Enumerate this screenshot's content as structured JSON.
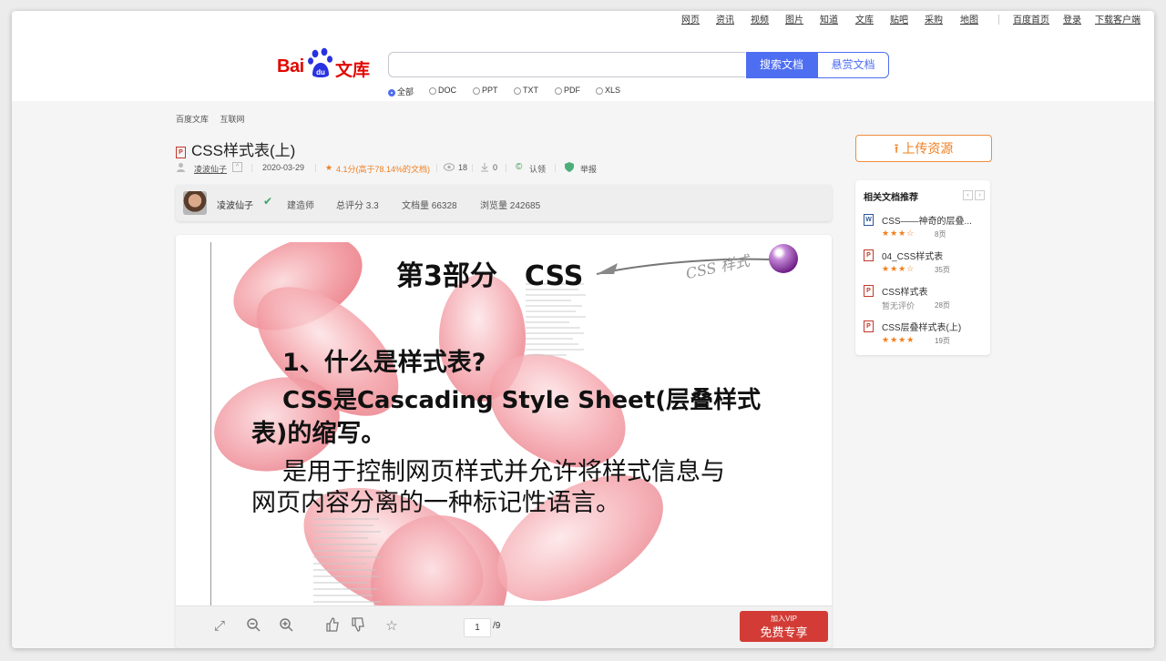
{
  "topnav": {
    "links": [
      "网页",
      "资讯",
      "视频",
      "图片",
      "知道",
      "文库",
      "贴吧",
      "采购",
      "地图"
    ],
    "right_links": [
      "百度首页",
      "登录",
      "下载客户端"
    ]
  },
  "logo": {
    "bai": "Bai",
    "du": "du",
    "wenku": "文库"
  },
  "search": {
    "value": "",
    "search_button": "搜索文档",
    "reward_button": "悬赏文档",
    "filters": [
      "全部",
      "DOC",
      "PPT",
      "TXT",
      "PDF",
      "XLS"
    ],
    "selected_filter": "全部"
  },
  "breadcrumb": [
    "百度文库",
    "互联网"
  ],
  "document": {
    "type_icon": "P",
    "title": "CSS样式表(上)",
    "author": "凌波仙子",
    "date": "2020-03-29",
    "rating_text": "4.1分(高于78.14%的文档)",
    "views": "18",
    "downloads": "0",
    "claim": "认领",
    "report": "举报"
  },
  "author_card": {
    "name": "凌波仙子",
    "role": "建造师",
    "total_score": "总评分 3.3",
    "doc_count": "文档量 66328",
    "view_count": "浏览量 242685"
  },
  "slide": {
    "title": "第3部分　CSS",
    "tag": "CSS 样式",
    "heading": "1、什么是样式表?",
    "line1": "CSS是Cascading Style Sheet(层叠样式",
    "line2": "表)的缩写。",
    "line3": "是用于控制网页样式并允许将样式信息与",
    "line4": "网页内容分离的一种标记性语言。"
  },
  "toolbar": {
    "page_current": "1",
    "page_total": "/9",
    "vip_line1": "加入VIP",
    "vip_line2": "免费专享"
  },
  "sidebar": {
    "upload_label": "上传资源",
    "recommend_title": "相关文档推荐",
    "items": [
      {
        "icon": "W",
        "title": "CSS——神奇的层叠...",
        "stars": "★★★☆",
        "pages": "8页"
      },
      {
        "icon": "P",
        "title": "04_CSS样式表",
        "stars": "★★★☆",
        "pages": "35页"
      },
      {
        "icon": "P",
        "title": "CSS样式表",
        "stars": "暂无评价",
        "pages": "28页"
      },
      {
        "icon": "P",
        "title": "CSS层叠样式表(上)",
        "stars": "★★★★",
        "pages": "19页"
      }
    ]
  },
  "colors": {
    "brand_red": "#e10601",
    "brand_blue": "#4e6ef2",
    "orange": "#f07f1f",
    "vip_red": "#d33c36"
  }
}
